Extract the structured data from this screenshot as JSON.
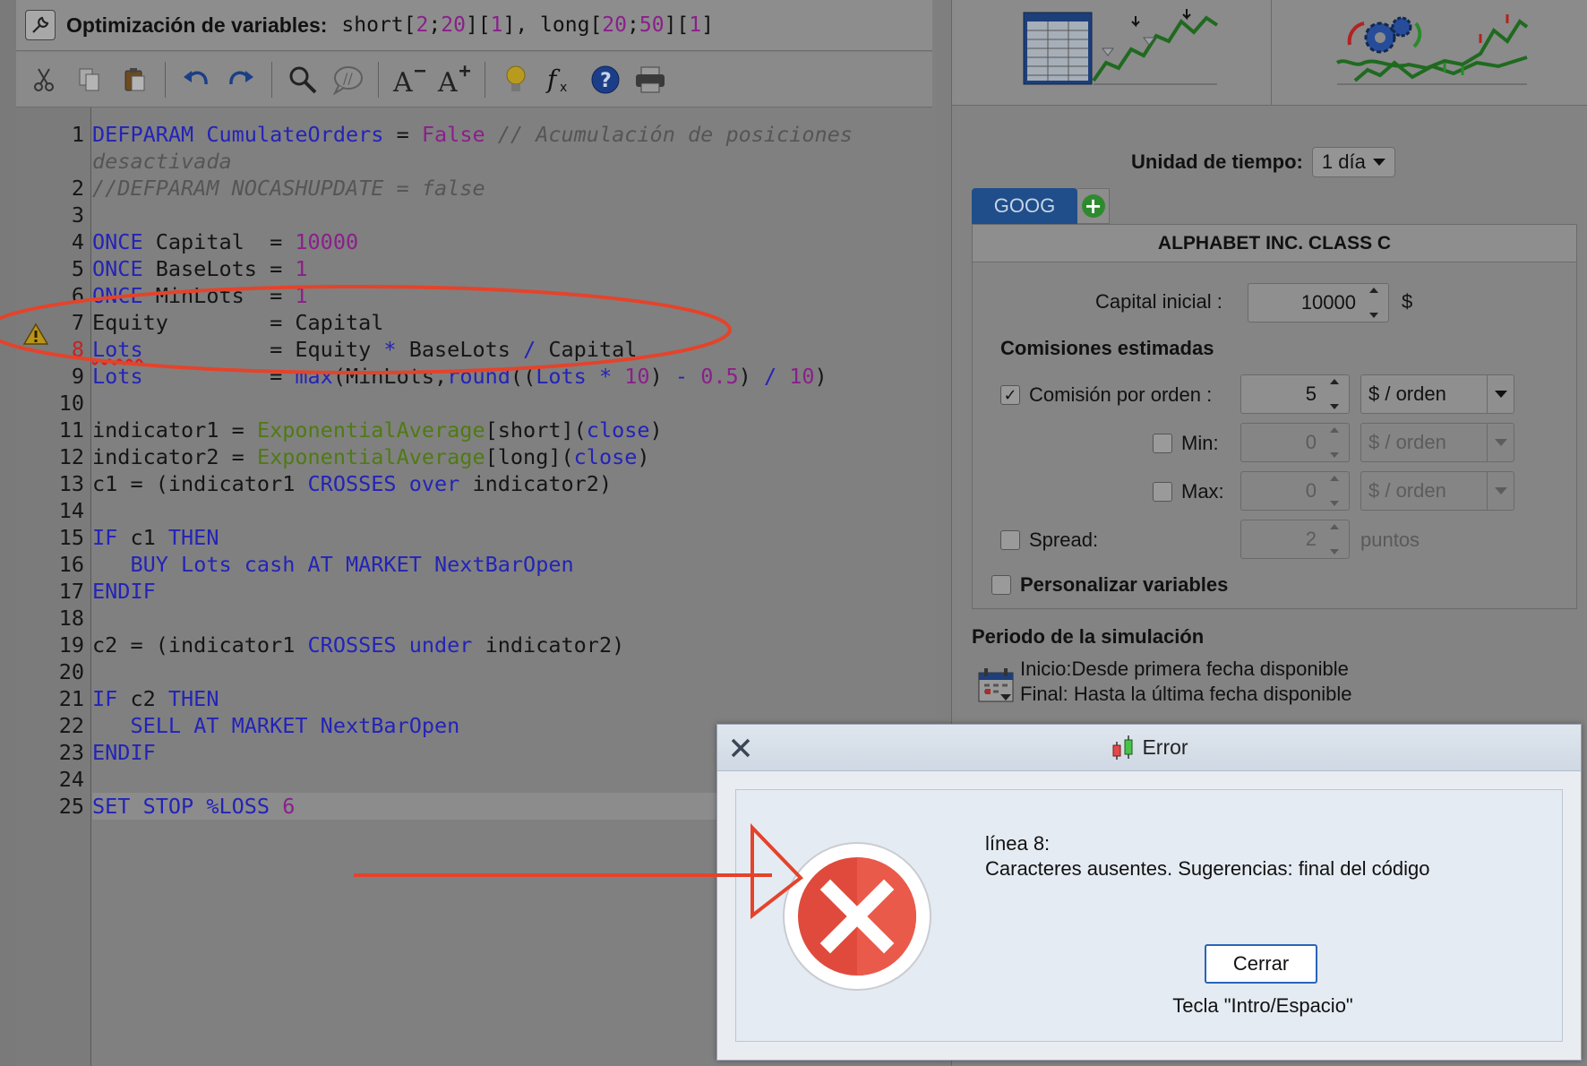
{
  "editor": {
    "title_label": "Optimización de variables:",
    "title_params": [
      {
        "t": "short[",
        "c": ""
      },
      {
        "t": "2",
        "c": "num"
      },
      {
        "t": ";",
        "c": ""
      },
      {
        "t": "20",
        "c": "num"
      },
      {
        "t": "]",
        "c": ""
      },
      {
        "t": "[",
        "c": ""
      },
      {
        "t": "1",
        "c": "num"
      },
      {
        "t": "], long[",
        "c": ""
      },
      {
        "t": "20",
        "c": "num"
      },
      {
        "t": ";",
        "c": ""
      },
      {
        "t": "50",
        "c": "num"
      },
      {
        "t": "]",
        "c": ""
      },
      {
        "t": "[",
        "c": ""
      },
      {
        "t": "1",
        "c": "num"
      },
      {
        "t": "]",
        "c": ""
      }
    ],
    "toolbar": [
      "cut-icon",
      "copy-icon",
      "paste-icon",
      "undo-icon",
      "redo-icon",
      "search-icon",
      "comment-icon",
      "font-decrease-icon",
      "font-increase-icon",
      "lightbulb-icon",
      "function-icon",
      "help-icon",
      "print-icon"
    ],
    "lines": [
      {
        "n": "1",
        "tokens": [
          {
            "t": "DEFPARAM",
            "c": "kw"
          },
          {
            "t": " ",
            "c": ""
          },
          {
            "t": "CumulateOrders",
            "c": "kw"
          },
          {
            "t": " = ",
            "c": ""
          },
          {
            "t": "False",
            "c": "num"
          },
          {
            "t": " // Acumulación de posiciones",
            "c": "cm"
          }
        ]
      },
      {
        "n": "",
        "tokens": [
          {
            "t": "desactivada",
            "c": "cm"
          }
        ]
      },
      {
        "n": "2",
        "tokens": [
          {
            "t": "//DEFPARAM NOCASHUPDATE = false",
            "c": "cm"
          }
        ]
      },
      {
        "n": "3",
        "tokens": []
      },
      {
        "n": "4",
        "tokens": [
          {
            "t": "ONCE",
            "c": "kw"
          },
          {
            "t": " Capital  = ",
            "c": ""
          },
          {
            "t": "10000",
            "c": "num"
          }
        ]
      },
      {
        "n": "5",
        "tokens": [
          {
            "t": "ONCE",
            "c": "kw"
          },
          {
            "t": " BaseLots = ",
            "c": ""
          },
          {
            "t": "1",
            "c": "num"
          }
        ]
      },
      {
        "n": "6",
        "tokens": [
          {
            "t": "ONCE",
            "c": "kw"
          },
          {
            "t": " MinLots  = ",
            "c": ""
          },
          {
            "t": "1",
            "c": "num"
          }
        ]
      },
      {
        "n": "7",
        "tokens": [
          {
            "t": "Equity        = Capital",
            "c": ""
          }
        ]
      },
      {
        "n": "8",
        "err": true,
        "tokens": [
          {
            "t": "Lots",
            "c": "kw err-word"
          },
          {
            "t": "          = Equity ",
            "c": ""
          },
          {
            "t": "*",
            "c": "kw"
          },
          {
            "t": " BaseLots ",
            "c": ""
          },
          {
            "t": "/",
            "c": "kw"
          },
          {
            "t": " Capital",
            "c": ""
          }
        ]
      },
      {
        "n": "9",
        "tokens": [
          {
            "t": "Lots",
            "c": "kw"
          },
          {
            "t": "          = ",
            "c": ""
          },
          {
            "t": "max",
            "c": "kw"
          },
          {
            "t": "(MinLots,",
            "c": ""
          },
          {
            "t": "round",
            "c": "kw"
          },
          {
            "t": "((",
            "c": ""
          },
          {
            "t": "Lots",
            "c": "kw"
          },
          {
            "t": " ",
            "c": ""
          },
          {
            "t": "*",
            "c": "kw"
          },
          {
            "t": " ",
            "c": ""
          },
          {
            "t": "10",
            "c": "num"
          },
          {
            "t": ") ",
            "c": ""
          },
          {
            "t": "-",
            "c": "kw"
          },
          {
            "t": " ",
            "c": ""
          },
          {
            "t": "0.5",
            "c": "num"
          },
          {
            "t": ") ",
            "c": ""
          },
          {
            "t": "/",
            "c": "kw"
          },
          {
            "t": " ",
            "c": ""
          },
          {
            "t": "10",
            "c": "num"
          },
          {
            "t": ")",
            "c": ""
          }
        ]
      },
      {
        "n": "10",
        "tokens": []
      },
      {
        "n": "11",
        "tokens": [
          {
            "t": "indicator1 = ",
            "c": ""
          },
          {
            "t": "ExponentialAverage",
            "c": "fn"
          },
          {
            "t": "[short](",
            "c": ""
          },
          {
            "t": "close",
            "c": "kw"
          },
          {
            "t": ")",
            "c": ""
          }
        ]
      },
      {
        "n": "12",
        "tokens": [
          {
            "t": "indicator2 = ",
            "c": ""
          },
          {
            "t": "ExponentialAverage",
            "c": "fn"
          },
          {
            "t": "[long](",
            "c": ""
          },
          {
            "t": "close",
            "c": "kw"
          },
          {
            "t": ")",
            "c": ""
          }
        ]
      },
      {
        "n": "13",
        "tokens": [
          {
            "t": "c1 = (indicator1 ",
            "c": ""
          },
          {
            "t": "CROSSES over",
            "c": "kw"
          },
          {
            "t": " indicator2)",
            "c": ""
          }
        ]
      },
      {
        "n": "14",
        "tokens": []
      },
      {
        "n": "15",
        "tokens": [
          {
            "t": "IF",
            "c": "kw"
          },
          {
            "t": " c1 ",
            "c": ""
          },
          {
            "t": "THEN",
            "c": "kw"
          }
        ]
      },
      {
        "n": "16",
        "tokens": [
          {
            "t": "   ",
            "c": ""
          },
          {
            "t": "BUY Lots cash AT MARKET NextBarOpen",
            "c": "kw"
          }
        ]
      },
      {
        "n": "17",
        "tokens": [
          {
            "t": "ENDIF",
            "c": "kw"
          }
        ]
      },
      {
        "n": "18",
        "tokens": []
      },
      {
        "n": "19",
        "tokens": [
          {
            "t": "c2 = (indicator1 ",
            "c": ""
          },
          {
            "t": "CROSSES under",
            "c": "kw"
          },
          {
            "t": " indicator2)",
            "c": ""
          }
        ]
      },
      {
        "n": "20",
        "tokens": []
      },
      {
        "n": "21",
        "tokens": [
          {
            "t": "IF",
            "c": "kw"
          },
          {
            "t": " c2 ",
            "c": ""
          },
          {
            "t": "THEN",
            "c": "kw"
          }
        ]
      },
      {
        "n": "22",
        "tokens": [
          {
            "t": "   ",
            "c": ""
          },
          {
            "t": "SELL AT MARKET NextBarOpen",
            "c": "kw"
          }
        ]
      },
      {
        "n": "23",
        "tokens": [
          {
            "t": "ENDIF",
            "c": "kw"
          }
        ]
      },
      {
        "n": "24",
        "tokens": []
      },
      {
        "n": "25",
        "hl": true,
        "tokens": [
          {
            "t": "SET STOP %LOSS ",
            "c": "kw"
          },
          {
            "t": "6",
            "c": "num"
          }
        ]
      }
    ]
  },
  "settings": {
    "time_unit_label": "Unidad de tiempo:",
    "time_unit_value": "1 día",
    "tab_label": "GOOG",
    "symbol_name": "ALPHABET INC. CLASS C",
    "capital_label": "Capital inicial :",
    "capital_value": "10000",
    "capital_unit": "$",
    "commissions_title": "Comisiones estimadas",
    "per_order_label": "Comisión por orden :",
    "per_order_value": "5",
    "per_order_unit": "$ / orden",
    "min_label": "Min:",
    "min_value": "0",
    "min_unit": "$ / orden",
    "max_label": "Max:",
    "max_value": "0",
    "max_unit": "$ / orden",
    "spread_label": "Spread:",
    "spread_value": "2",
    "spread_unit": "puntos",
    "custom_vars_label": "Personalizar variables",
    "period_title": "Periodo de la simulación",
    "start_text": "Inicio:Desde primera fecha disponible",
    "end_text": "Final: Hasta la última fecha disponible"
  },
  "dialog": {
    "title": "Error",
    "line_text": "línea 8:",
    "message": "Caracteres ausentes. Sugerencias: final del código",
    "button_label": "Cerrar",
    "hint": "Tecla \"Intro/Espacio\""
  },
  "colors": {
    "annotation": "#e4432b",
    "keyword": "#2323b8",
    "number": "#8a1f8a",
    "error_red": "#e04a3c"
  }
}
